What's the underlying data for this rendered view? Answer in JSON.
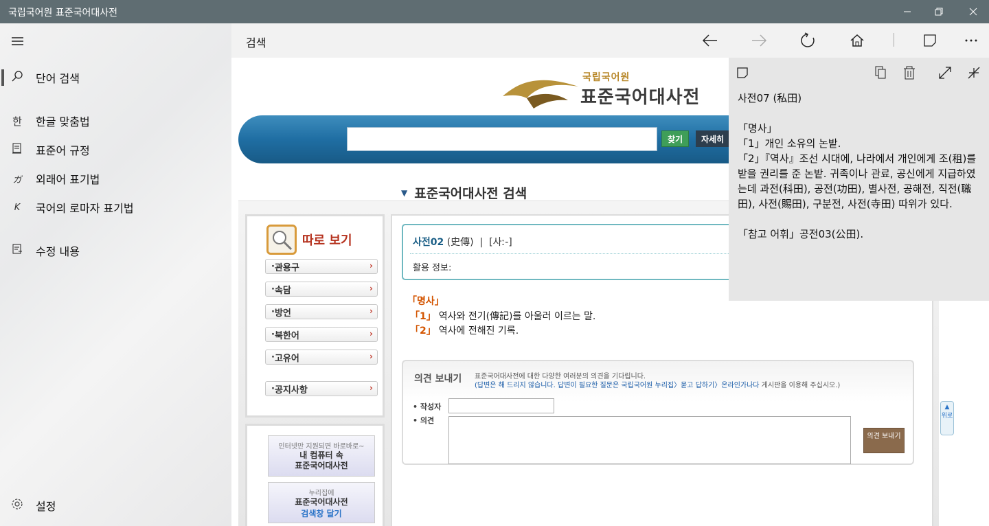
{
  "window": {
    "title": "국립국어원 표준국어대사전"
  },
  "sidebar": {
    "items": [
      {
        "icon": "search-icon",
        "glyph": "⚲",
        "label": "단어 검색",
        "selected": true
      },
      {
        "icon": "hangul-icon",
        "glyph": "한",
        "label": "한글 맞춤법"
      },
      {
        "icon": "document-icon",
        "glyph": "▤",
        "label": "표준어 규정"
      },
      {
        "icon": "katakana-icon",
        "glyph": "ガ",
        "label": "외래어 표기법"
      },
      {
        "icon": "roman-k-icon",
        "glyph": "K",
        "label": "국어의 로마자 표기법"
      },
      {
        "icon": "edit-doc-icon",
        "glyph": "▤",
        "label": "수정 내용"
      }
    ],
    "settings_label": "설정"
  },
  "toolbar": {
    "title": "검색"
  },
  "site": {
    "org": "국립국어원",
    "dict": "표준국어대사전",
    "find_btn": "찾기",
    "detail_btn": "자세히",
    "section_title": "표준국어대사전 검색",
    "side_head": "따로 보기",
    "side_links": [
      "관용구",
      "속담",
      "방언",
      "북한어",
      "고유어"
    ],
    "notice": "공지사항",
    "promo1": {
      "small": "인터넷만 지원되면 바로바로~",
      "line1": "내 컴퓨터 속",
      "line2": "표준국어대사전"
    },
    "promo2": {
      "small": "누리집에",
      "line1": "표준국어대사전",
      "line2": "검색창 달기"
    },
    "totop": "위로"
  },
  "entry": {
    "headword": "사전02",
    "hanja": "(史傳)",
    "pron": "[사ː-]",
    "usage": "활용 정보:",
    "pos": "「명사」",
    "senses": [
      {
        "num": "「1」",
        "text": "역사와 전기(傳記)를 아울러 이르는 말."
      },
      {
        "num": "「2」",
        "text": "역사에 전해진 기록."
      }
    ]
  },
  "opinion": {
    "title": "의견 보내기",
    "line1": "표준국어대사전에 대한 다양한 여러분의 의견을 기다립니다.",
    "line2a": "(답변은 해 드리지 않습니다. 답변이 필요한 질문은 국립국어원 누리집〉묻고 답하기〉온라인가나다",
    "line2b": " 게시판을 이용해 주십시오.)",
    "author_label": "• 작성자",
    "opinion_label": "• 의견",
    "send": "의견 보내기"
  },
  "popup": {
    "text": "사전07 (私田)\n\n「명사」\n「1」개인 소유의 논밭.\n「2」『역사』조선 시대에, 나라에서 개인에게 조(租)를 받을 권리를 준 논밭. 귀족이나 관료, 공신에게 지급하였는데 과전(科田), 공전(功田), 별사전, 공해전, 직전(職田), 사전(賜田), 구분전, 사전(寺田) 따위가 있다.\n\n「참고 어휘」공전03(公田)."
  }
}
